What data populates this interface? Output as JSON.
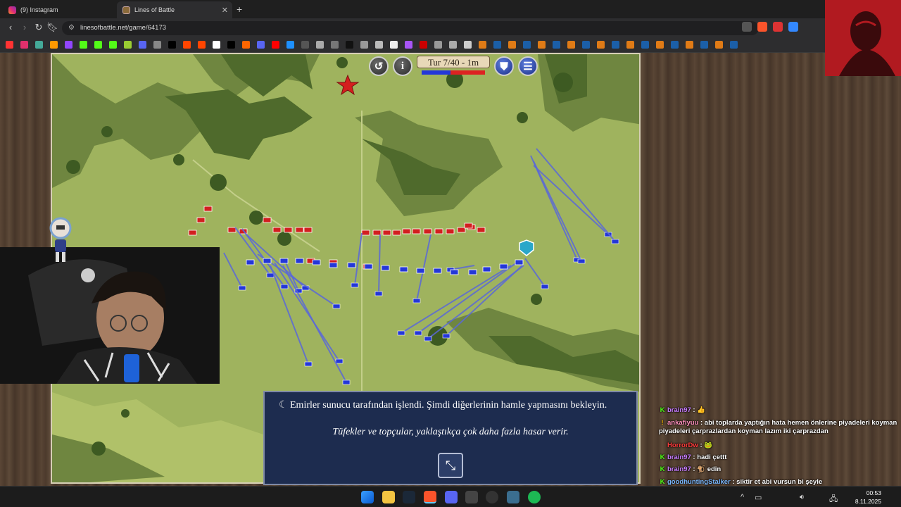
{
  "browser": {
    "tabs": [
      {
        "title": "(9) Instagram",
        "icon": "instagram-icon",
        "active": false
      },
      {
        "title": "Lines of Battle",
        "icon": "lines-of-battle-icon",
        "active": true
      }
    ],
    "url": "linesofbattle.net/game/64173"
  },
  "game": {
    "turn_label": "Tur 7/40 - 1m",
    "power_balance_blue": 0.45,
    "colors": {
      "blue_army": "#2437d8",
      "red_army": "#d21f1f",
      "field": "#9fb35e",
      "forest": "#6f8640"
    },
    "buttons": [
      {
        "icon": "undo-icon",
        "glyph": "↺"
      },
      {
        "icon": "info-icon",
        "glyph": "i"
      },
      {
        "icon": "faction-shield-icon",
        "glyph": "⛊"
      },
      {
        "icon": "menu-list-icon",
        "glyph": "☰"
      }
    ]
  },
  "notice": {
    "status": "Emirler sunucu tarafından işlendi. Şimdi diğerlerinin hamle yapmasını bekleyin.",
    "tip": "Tüfekler ve topçular, yaklaştıkça çok daha fazla hasar verir.",
    "collapse_icon": "collapse-icon"
  },
  "chat": [
    {
      "user": "brain97",
      "badge": "K",
      "user_color": "#c77dff",
      "text": ": 👍"
    },
    {
      "user": "ankafiyuu",
      "badge": "!",
      "user_color": "#ff8fbd",
      "text": ": abi toplarda yaptığın hata hemen önlerine piyadeleri koyman piyadeleri çarprazlardan koyman lazım iki çarprazdan"
    },
    {
      "user": "HorrorDw",
      "badge": "",
      "user_color": "#ff3b3b",
      "text": ": 🐸"
    },
    {
      "user": "brain97",
      "badge": "K",
      "user_color": "#c77dff",
      "text": ": hadi çettt"
    },
    {
      "user": "brain97",
      "badge": "K",
      "user_color": "#c77dff",
      "text": ": 🐒 edin"
    },
    {
      "user": "goodhuntingStalker",
      "badge": "K",
      "user_color": "#7ab8ff",
      "text": ": siktir et abi vursun bi şeyle"
    }
  ],
  "clock": {
    "time": "00:53",
    "date": "8.11.2025"
  }
}
